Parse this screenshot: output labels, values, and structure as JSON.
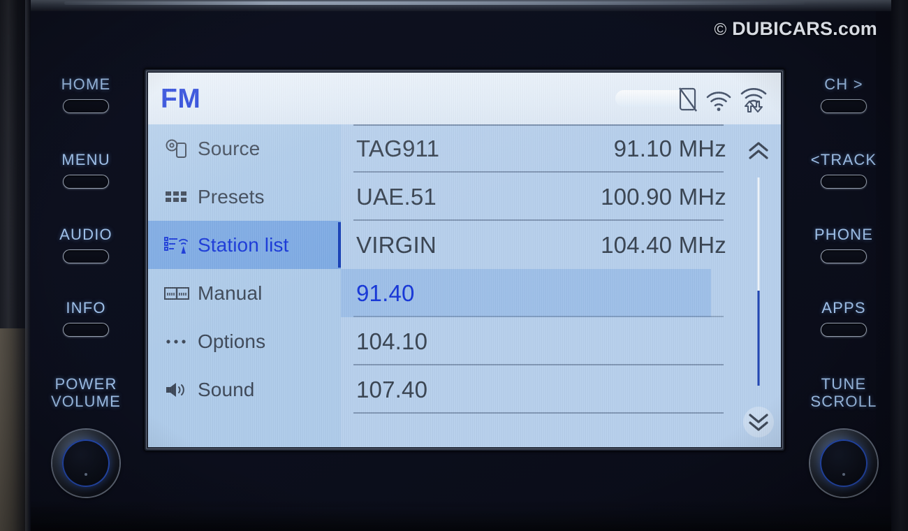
{
  "watermark": {
    "copyright": "©",
    "brand": "DUBICARS.com",
    "full": "© DUBICARS.com"
  },
  "screen": {
    "header": {
      "title": "FM",
      "title_color": "#1334d8",
      "status_icons": [
        {
          "name": "no-device-icon",
          "label": "device-disconnected"
        },
        {
          "name": "wifi-signal-icon",
          "label": "wifi"
        },
        {
          "name": "wifi-data-transfer-icon",
          "label": "wifi-data"
        }
      ]
    },
    "sidebar": {
      "items": [
        {
          "label": "Source",
          "icon": "source-icon",
          "selected": false
        },
        {
          "label": "Presets",
          "icon": "presets-grid-icon",
          "selected": false
        },
        {
          "label": "Station list",
          "icon": "station-list-icon",
          "selected": true
        },
        {
          "label": "Manual",
          "icon": "manual-tune-icon",
          "selected": false
        },
        {
          "label": "Options",
          "icon": "options-dots-icon",
          "selected": false
        },
        {
          "label": "Sound",
          "icon": "speaker-icon",
          "selected": false
        }
      ],
      "selected_bg": "#7daae4",
      "selected_text": "#1334d8"
    },
    "station_list": {
      "rows": [
        {
          "name": "TAG911",
          "frequency": "91.10 MHz",
          "active": false
        },
        {
          "name": "UAE.51",
          "frequency": "100.90 MHz",
          "active": false
        },
        {
          "name": "VIRGIN",
          "frequency": "104.40 MHz",
          "active": false
        },
        {
          "name": "91.40",
          "frequency": "",
          "active": true
        },
        {
          "name": "104.10",
          "frequency": "",
          "active": false
        },
        {
          "name": "107.40",
          "frequency": "",
          "active": false
        }
      ],
      "active_bg": "#9dbfe8",
      "active_text": "#1334d8"
    },
    "scrollbar": {
      "up_arrow": "chevron-double-up",
      "down_arrow": "chevron-double-down",
      "thumb_color": "#1a3fb0"
    }
  },
  "hardware": {
    "left_buttons": [
      {
        "label": "HOME"
      },
      {
        "label": "MENU"
      },
      {
        "label": "AUDIO"
      },
      {
        "label": "INFO"
      }
    ],
    "left_knob": {
      "line1": "POWER",
      "line2": "VOLUME"
    },
    "right_buttons": [
      {
        "label": "CH >"
      },
      {
        "label": "<TRACK"
      },
      {
        "label": "PHONE"
      },
      {
        "label": "APPS"
      }
    ],
    "right_knob": {
      "line1": "TUNE",
      "line2": "SCROLL"
    },
    "label_color": "#9fc0e8"
  }
}
